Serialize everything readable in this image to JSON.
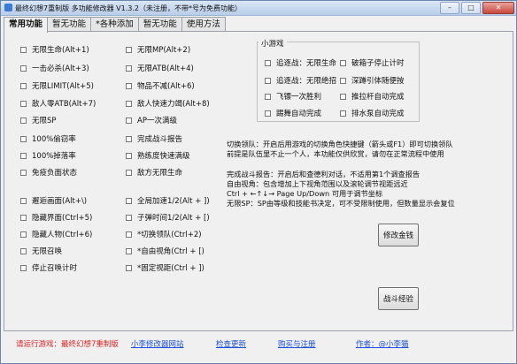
{
  "window": {
    "title": "最终幻想7重制版 多功能修改器  V1.3.2（未注册，不带*号为免费功能）",
    "min_label": "–",
    "max_label": "□",
    "close_label": "✕"
  },
  "tabs": [
    {
      "label": "常用功能",
      "active": true
    },
    {
      "label": "暂无功能",
      "active": false
    },
    {
      "label": "*各种添加",
      "active": false
    },
    {
      "label": "暂无功能",
      "active": false
    },
    {
      "label": "使用方法",
      "active": false
    }
  ],
  "left_column": [
    "无限生命(Alt+1)",
    "一击必杀(Alt+3)",
    "无限LIMIT(Alt+5)",
    "敌人零ATB(Alt+7)",
    "无限SP",
    "100%偷窃率",
    "100%掉落率",
    "免疫负面状态",
    "",
    "邂逅画面(Alt+\\)",
    "隐藏界面(Ctrl+5)",
    "隐藏人物(Ctrl+6)",
    "无限召唤",
    "停止召唤计时"
  ],
  "mid_column": [
    "无限MP(Alt+2)",
    "无限ATB(Alt+4)",
    "物品不减(Alt+6)",
    "敌人快速力竭(Alt+8)",
    "AP一次满级",
    "完成战斗报告",
    "熟练度快速满级",
    "敌方无限生命",
    "",
    "全局加速1/2(Alt + ])",
    "子弹时间1/2(Alt + [)",
    "*切换领队(Ctrl+2)",
    "*自由视角(Ctrl + [)",
    "*固定视距(Ctrl + ])"
  ],
  "minigame": {
    "title": "小游戏",
    "items": [
      "追逐战：无限生命",
      "破箱子停止计时",
      "追逐战：无限绝招",
      "深蹲引体随便按",
      "飞镖一次胜利",
      "推拉杆自动完成",
      "踢舞自动完成",
      "排水泵自动完成"
    ]
  },
  "info_lines": [
    "切换领队：开启后用游戏的切换角色快捷键（箭头或F1）即可切换领队",
    "前提是队伍里不止一个人，本功能仅供欣赏，请勿在正常流程中使用",
    "",
    "完成战斗报告：开启后和查德利对话，不适用第1个调查报告",
    "自由视角：包含增加上下视角范围以及滚轮调节视距远近",
    "Ctrl + ←↑↓→  Page Up/Down 可用于调节坐标",
    "无限SP：SP由等级和技能书决定，可不受限制使用，但数量显示会复位"
  ],
  "buttons": {
    "modify_money": "修改金钱",
    "battle_exp": "战斗经验"
  },
  "status": {
    "game_hint": "请运行游戏：最终幻想7重制版",
    "website": "小李修改器网站",
    "check_update": "检查更新",
    "buy_register": "购买与注册",
    "author": "作者：@小李猫"
  }
}
